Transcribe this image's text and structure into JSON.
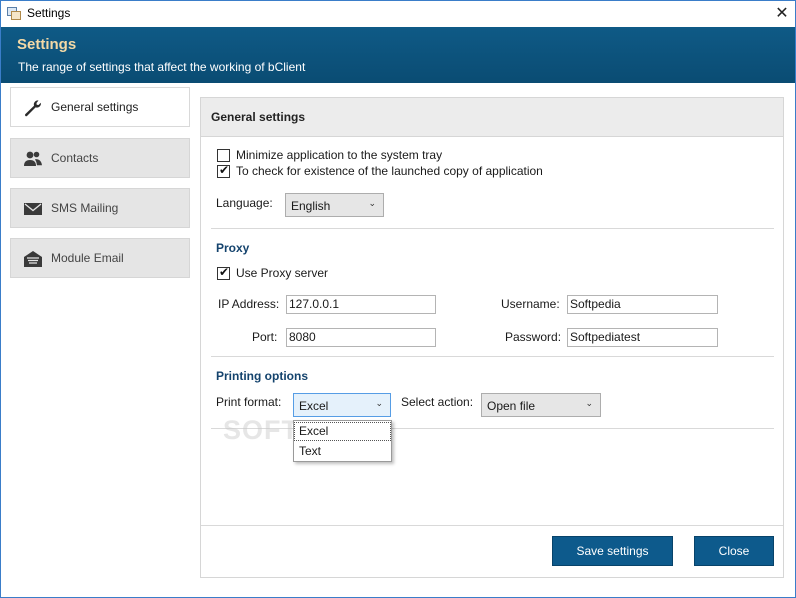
{
  "window": {
    "title": "Settings",
    "close_icon": "close-icon"
  },
  "header": {
    "title": "Settings",
    "subtitle": "The range of settings that affect the working of bClient"
  },
  "sidebar": {
    "items": [
      {
        "label": "General settings",
        "icon": "wrench-icon",
        "active": true
      },
      {
        "label": "Contacts",
        "icon": "contacts-icon",
        "active": false
      },
      {
        "label": "SMS Mailing",
        "icon": "envelope-icon",
        "active": false
      },
      {
        "label": "Module Email",
        "icon": "open-mail-icon",
        "active": false
      }
    ]
  },
  "panel": {
    "title": "General settings",
    "minimize_to_tray": {
      "label": "Minimize application to the system tray",
      "checked": false
    },
    "check_launched_copy": {
      "label": "To check for existence of the launched copy of application",
      "checked": true
    },
    "language": {
      "label": "Language:",
      "value": "English"
    }
  },
  "proxy": {
    "title": "Proxy",
    "use_proxy": {
      "label": "Use Proxy server",
      "checked": true
    },
    "ip_label": "IP Address:",
    "ip_value": "127.0.0.1",
    "port_label": "Port:",
    "port_value": "8080",
    "username_label": "Username:",
    "username_value": "Softpedia",
    "password_label": "Password:",
    "password_value": "Softpediatest"
  },
  "printing": {
    "title": "Printing options",
    "format_label": "Print format:",
    "format_value": "Excel",
    "format_options": [
      "Excel",
      "Text"
    ],
    "action_label": "Select action:",
    "action_value": "Open file"
  },
  "watermark": "SOFTPEDIA",
  "buttons": {
    "save": "Save settings",
    "close": "Close"
  },
  "colors": {
    "header_bg": "#0d5682",
    "header_title": "#f3d9a6",
    "section_title": "#14436d",
    "button_bg": "#0d5a8c"
  }
}
